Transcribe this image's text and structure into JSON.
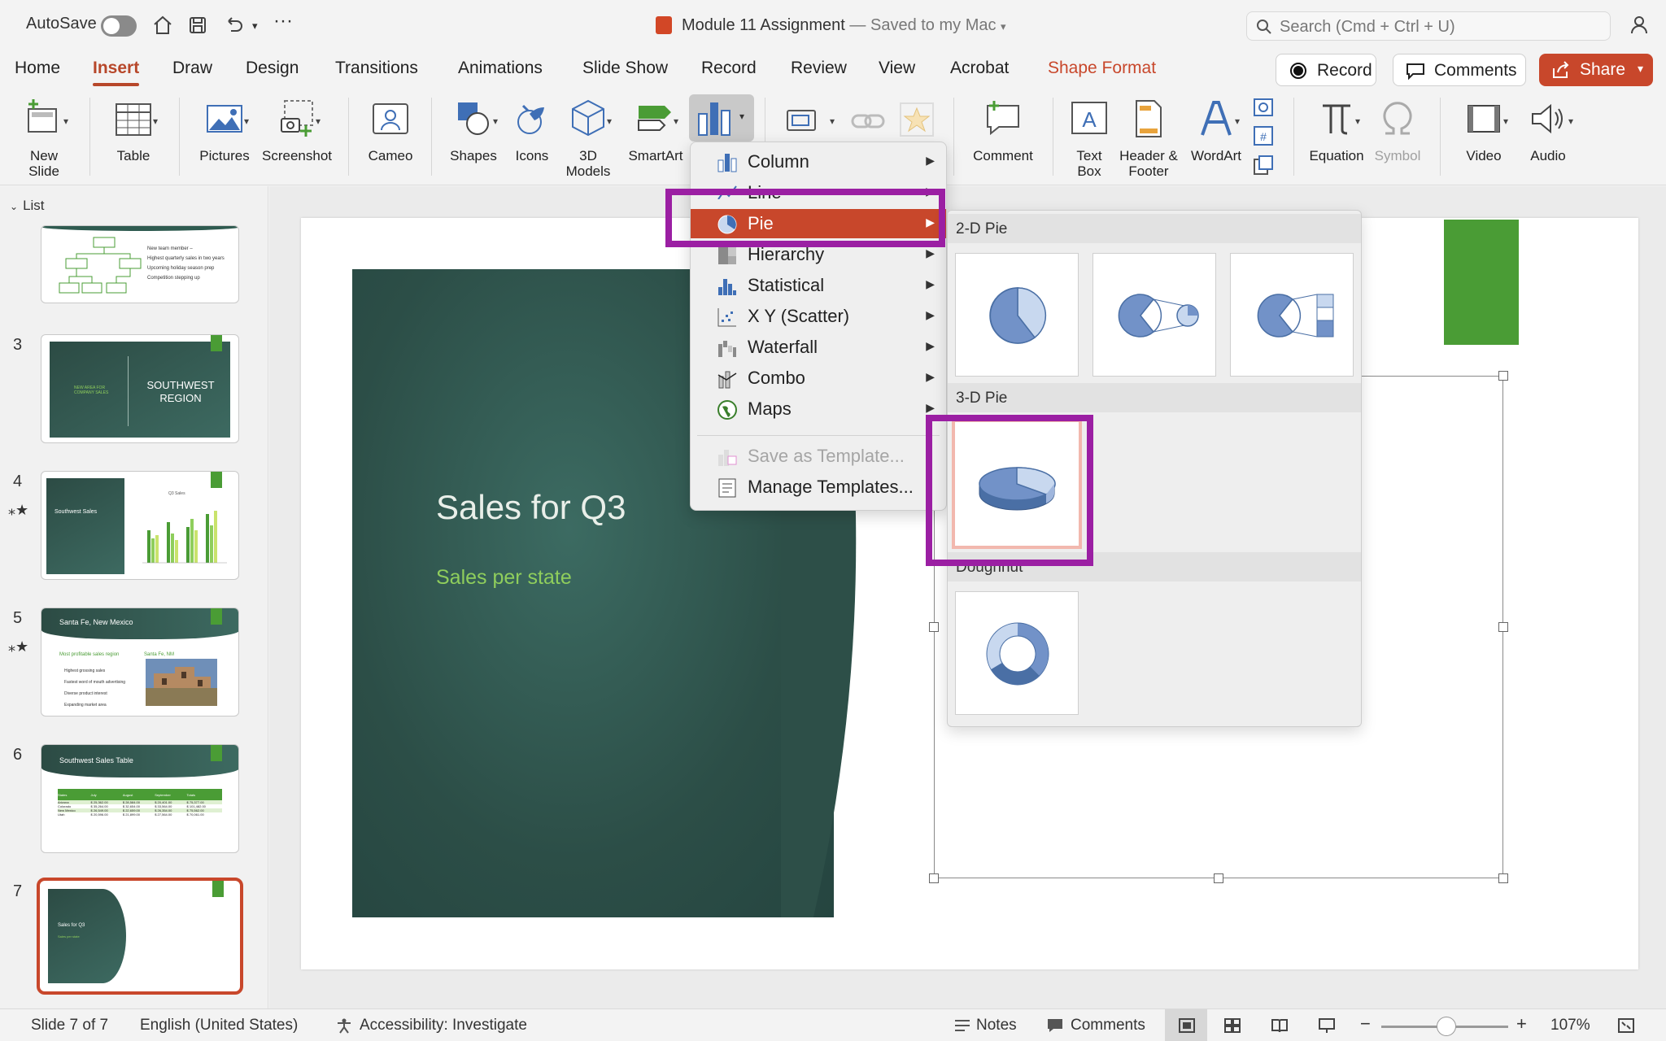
{
  "titlebar": {
    "autosave_label": "AutoSave",
    "doc_title": "Module 11 Assignment",
    "doc_status": "— Saved to my Mac",
    "search_placeholder": "Search (Cmd + Ctrl + U)"
  },
  "tabs": [
    "Home",
    "Insert",
    "Draw",
    "Design",
    "Transitions",
    "Animations",
    "Slide Show",
    "Record",
    "Review",
    "View",
    "Acrobat",
    "Shape Format"
  ],
  "active_tab": "Insert",
  "header_buttons": {
    "record": "Record",
    "comments": "Comments",
    "share": "Share"
  },
  "ribbon": {
    "new_slide": [
      "New",
      "Slide"
    ],
    "table": "Table",
    "pictures": "Pictures",
    "screenshot": "Screenshot",
    "cameo": "Cameo",
    "shapes": "Shapes",
    "icons": "Icons",
    "models3d": [
      "3D",
      "Models"
    ],
    "smartart": "SmartArt",
    "comment": "Comment",
    "textbox": [
      "Text",
      "Box"
    ],
    "header_footer": [
      "Header &",
      "Footer"
    ],
    "wordart": "WordArt",
    "equation": "Equation",
    "symbol": "Symbol",
    "video": "Video",
    "audio": "Audio"
  },
  "left_panel": {
    "list_label": "List",
    "slide_numbers": [
      "3",
      "4",
      "5",
      "6",
      "7"
    ],
    "thumb_texts": {
      "s2_bullets": [
        "New team member –",
        "Highest quarterly sales in two years",
        "Upcoming holiday season prep",
        "Competition stepping up"
      ],
      "s3_left": "NEW AREA FOR COMPANY SALES",
      "s3_title": "SOUTHWEST REGION",
      "s4_title": "Southwest Sales",
      "s4_chart_title": "Q3 Sales",
      "s5_title": "Santa Fe, New Mexico",
      "s5_sub": "Most profitable sales region",
      "s5_img_label": "Santa Fe, NM",
      "s5_bullets": [
        "Highest grossing sales",
        "Fastest word of mouth advertising",
        "Diverse product interest",
        "Expanding market area"
      ],
      "s6_title": "Southwest Sales Table",
      "s6_headers": [
        "States",
        "July",
        "August",
        "September",
        "Totals"
      ],
      "s6_rows": [
        [
          "Arizona",
          "$ 25,362.00",
          "$ 28,584.00",
          "$ 20,401.00",
          "$ 75,377.00"
        ],
        [
          "Colorado",
          "$ 35,264.00",
          "$ 32,654.00",
          "$ 33,564.00",
          "$ 101,482.00"
        ],
        [
          "New Mexico",
          "$ 26,549.00",
          "$ 22,659.00",
          "$ 26,354.00",
          "$ 75,562.00"
        ],
        [
          "Utah",
          "$ 20,596.00",
          "$ 21,899.00",
          "$ 27,564.00",
          "$ 70,061.00"
        ]
      ],
      "s7_title": "Sales for Q3",
      "s7_sub": "Sales per state"
    }
  },
  "slide": {
    "title": "Sales for Q3",
    "subtitle": "Sales per state"
  },
  "chart_menu": {
    "items": [
      "Column",
      "Line",
      "Pie",
      "Hierarchy",
      "Statistical",
      "X Y (Scatter)",
      "Waterfall",
      "Combo",
      "Maps"
    ],
    "active": "Pie",
    "save_template": "Save as Template...",
    "manage_templates": "Manage Templates..."
  },
  "pie_menu": {
    "section_2d": "2-D Pie",
    "section_3d": "3-D Pie",
    "section_doughnut": "Doughnut"
  },
  "statusbar": {
    "slide_count": "Slide 7 of 7",
    "language": "English (United States)",
    "accessibility": "Accessibility: Investigate",
    "notes": "Notes",
    "comments": "Comments",
    "zoom": "107%"
  },
  "colors": {
    "accent": "#c8472b",
    "highlight": "#9b1fa3",
    "slide_green": "#4a9c35",
    "pie_dark": "#6f8fc6",
    "pie_light": "#c8d8ef"
  }
}
